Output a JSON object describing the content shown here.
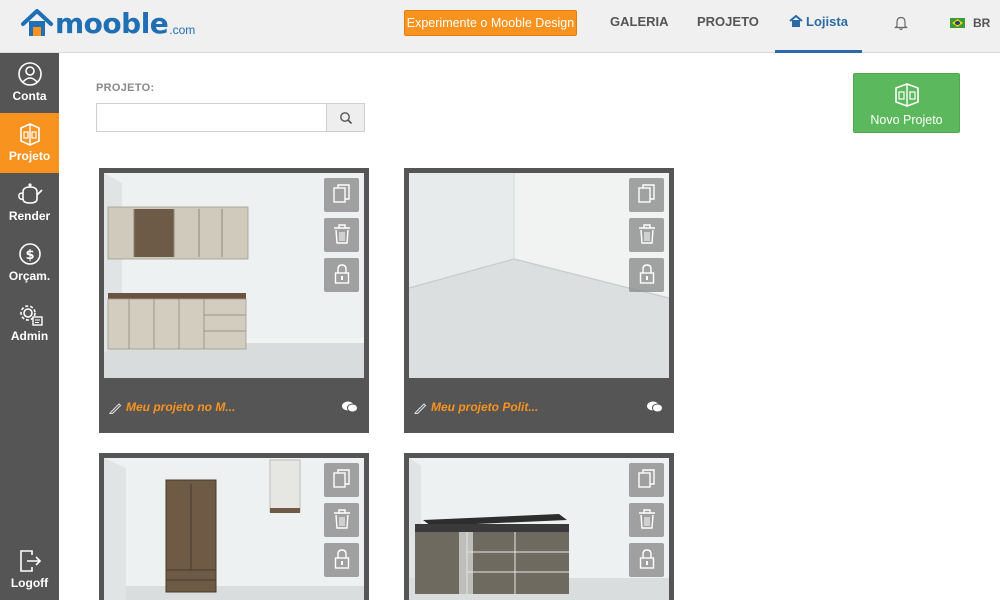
{
  "brand": {
    "name": "mooble",
    "domain": ".com"
  },
  "header": {
    "cta_label": "Experimente o Mooble Design",
    "nav": {
      "galeria": "GALERIA",
      "projeto": "PROJETO",
      "lojista": "Lojista"
    },
    "language": "BR"
  },
  "sidebar": {
    "items": [
      {
        "label": "Conta",
        "icon": "user-icon"
      },
      {
        "label": "Projeto",
        "icon": "room-icon",
        "active": true
      },
      {
        "label": "Render",
        "icon": "teapot-icon"
      },
      {
        "label": "Orçam.",
        "icon": "dollar-icon"
      },
      {
        "label": "Admin",
        "icon": "settings-icon"
      }
    ],
    "logoff": "Logoff"
  },
  "filter": {
    "label": "PROJETO:",
    "search_value": "",
    "search_placeholder": ""
  },
  "new_project_label": "Novo Projeto",
  "projects": [
    {
      "name": "Meu projeto no M..."
    },
    {
      "name": "Meu projeto Polit..."
    },
    {
      "name": ""
    },
    {
      "name": ""
    }
  ],
  "colors": {
    "accent": "#f7931e",
    "brand": "#1f6fb5",
    "sidebar": "#555555",
    "success": "#5cb85c"
  }
}
